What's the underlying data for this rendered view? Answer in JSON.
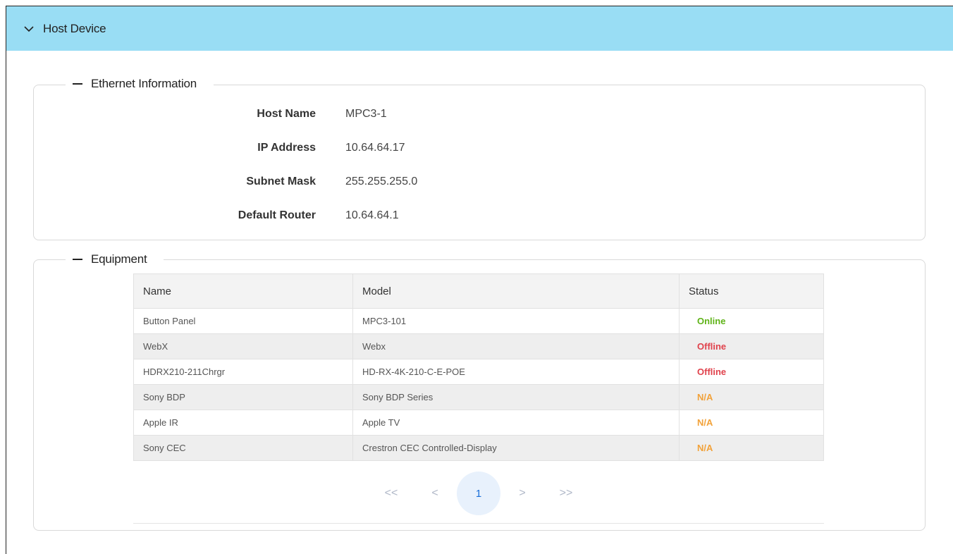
{
  "header": {
    "title": "Host Device",
    "icon": "chevron-down-icon"
  },
  "ethernet": {
    "legend": "Ethernet Information",
    "rows": [
      {
        "label": "Host Name",
        "value": "MPC3-1"
      },
      {
        "label": "IP Address",
        "value": "10.64.64.17"
      },
      {
        "label": "Subnet Mask",
        "value": "255.255.255.0"
      },
      {
        "label": "Default Router",
        "value": "10.64.64.1"
      }
    ]
  },
  "equipment": {
    "legend": "Equipment",
    "columns": [
      "Name",
      "Model",
      "Status"
    ],
    "rows": [
      {
        "name": "Button Panel",
        "model": "MPC3-101",
        "status": "Online",
        "status_color": "#5fb318"
      },
      {
        "name": "WebX",
        "model": "Webx",
        "status": "Offline",
        "status_color": "#e0424c"
      },
      {
        "name": "HDRX210-211Chrgr",
        "model": "HD-RX-4K-210-C-E-POE",
        "status": "Offline",
        "status_color": "#e0424c"
      },
      {
        "name": "Sony BDP",
        "model": "Sony BDP Series",
        "status": "N/A",
        "status_color": "#f2a23a"
      },
      {
        "name": "Apple IR",
        "model": "Apple TV",
        "status": "N/A",
        "status_color": "#f2a23a"
      },
      {
        "name": "Sony CEC",
        "model": "Crestron CEC Controlled-Display",
        "status": "N/A",
        "status_color": "#f2a23a"
      }
    ]
  },
  "pagination": {
    "first": "<<",
    "prev": "<",
    "current": "1",
    "next": ">",
    "last": ">>"
  },
  "colors": {
    "header_bg": "#99ddf4",
    "active_page": "#1a6fd9"
  }
}
